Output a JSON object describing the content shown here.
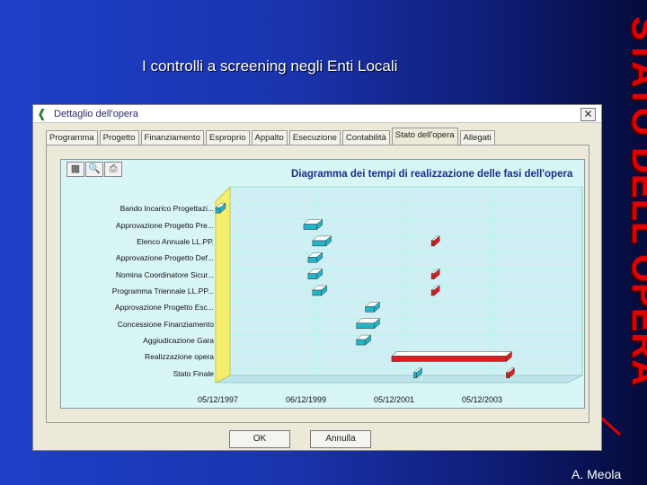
{
  "slide": {
    "title": "I controlli a screening negli Enti Locali",
    "side_title": "STATO DELL'OPERA",
    "author": "A. Meola"
  },
  "window": {
    "title": "Dettaglio dell'opera",
    "close_label": "✕",
    "tabs": [
      {
        "label": "Programma",
        "active": false
      },
      {
        "label": "Progetto",
        "active": false
      },
      {
        "label": "Finanziamento",
        "active": false
      },
      {
        "label": "Esproprio",
        "active": false
      },
      {
        "label": "Appalto",
        "active": false
      },
      {
        "label": "Esecuzione",
        "active": false
      },
      {
        "label": "Contabilità",
        "active": false
      },
      {
        "label": "Stato dell'opera",
        "active": true
      },
      {
        "label": "Allegati",
        "active": false
      }
    ],
    "toolbar_icons": [
      "chart-type-icon",
      "zoom-icon",
      "print-icon"
    ],
    "ok_label": "OK",
    "cancel_label": "Annulla"
  },
  "colors": {
    "accent_planned": "#20b5c8",
    "accent_actual": "#e01c1c",
    "baseline": "#f3ef6a",
    "side_title": "#e00000"
  },
  "chart_data": {
    "type": "gantt",
    "title": "Diagramma dei tempi di realizzazione delle fasi dell'opera",
    "x_ticks": [
      "05/12/1997",
      "06/12/1999",
      "05/12/2001",
      "05/12/2003"
    ],
    "x_range": [
      1997.0,
      2005.0
    ],
    "tasks": [
      {
        "name": "Bando Incarico Progettazi...",
        "planned": [
          1997.0,
          1997.1
        ],
        "actual": null
      },
      {
        "name": "Approvazione Progetto Pre...",
        "planned": [
          1999.0,
          1999.3
        ],
        "actual": null
      },
      {
        "name": "Elenco Annuale LL.PP.",
        "planned": [
          1999.2,
          1999.5
        ],
        "actual": [
          2001.9,
          2001.95
        ]
      },
      {
        "name": "Approvazione Progetto Def...",
        "planned": [
          1999.1,
          1999.3
        ],
        "actual": null
      },
      {
        "name": "Nomina Coordinatore Sicur...",
        "planned": [
          1999.1,
          1999.3
        ],
        "actual": [
          2001.9,
          2001.95
        ]
      },
      {
        "name": "Programma Triennale LL.PP...",
        "planned": [
          1999.2,
          1999.4
        ],
        "actual": [
          2001.9,
          2001.95
        ]
      },
      {
        "name": "Approvazione Progetto Esc...",
        "planned": [
          2000.4,
          2000.6
        ],
        "actual": null
      },
      {
        "name": "Concessione Finanziamento",
        "planned": [
          2000.2,
          2000.6
        ],
        "actual": null
      },
      {
        "name": "Aggiudicazione Gara",
        "planned": [
          2000.2,
          2000.4
        ],
        "actual": null
      },
      {
        "name": "Realizzazione opera",
        "planned": [
          2001.0,
          2001.2
        ],
        "actual": [
          2001.0,
          2003.6
        ]
      },
      {
        "name": "Stato Finale",
        "planned": [
          2001.5,
          2001.55
        ],
        "actual": [
          2003.6,
          2003.65
        ]
      }
    ]
  }
}
